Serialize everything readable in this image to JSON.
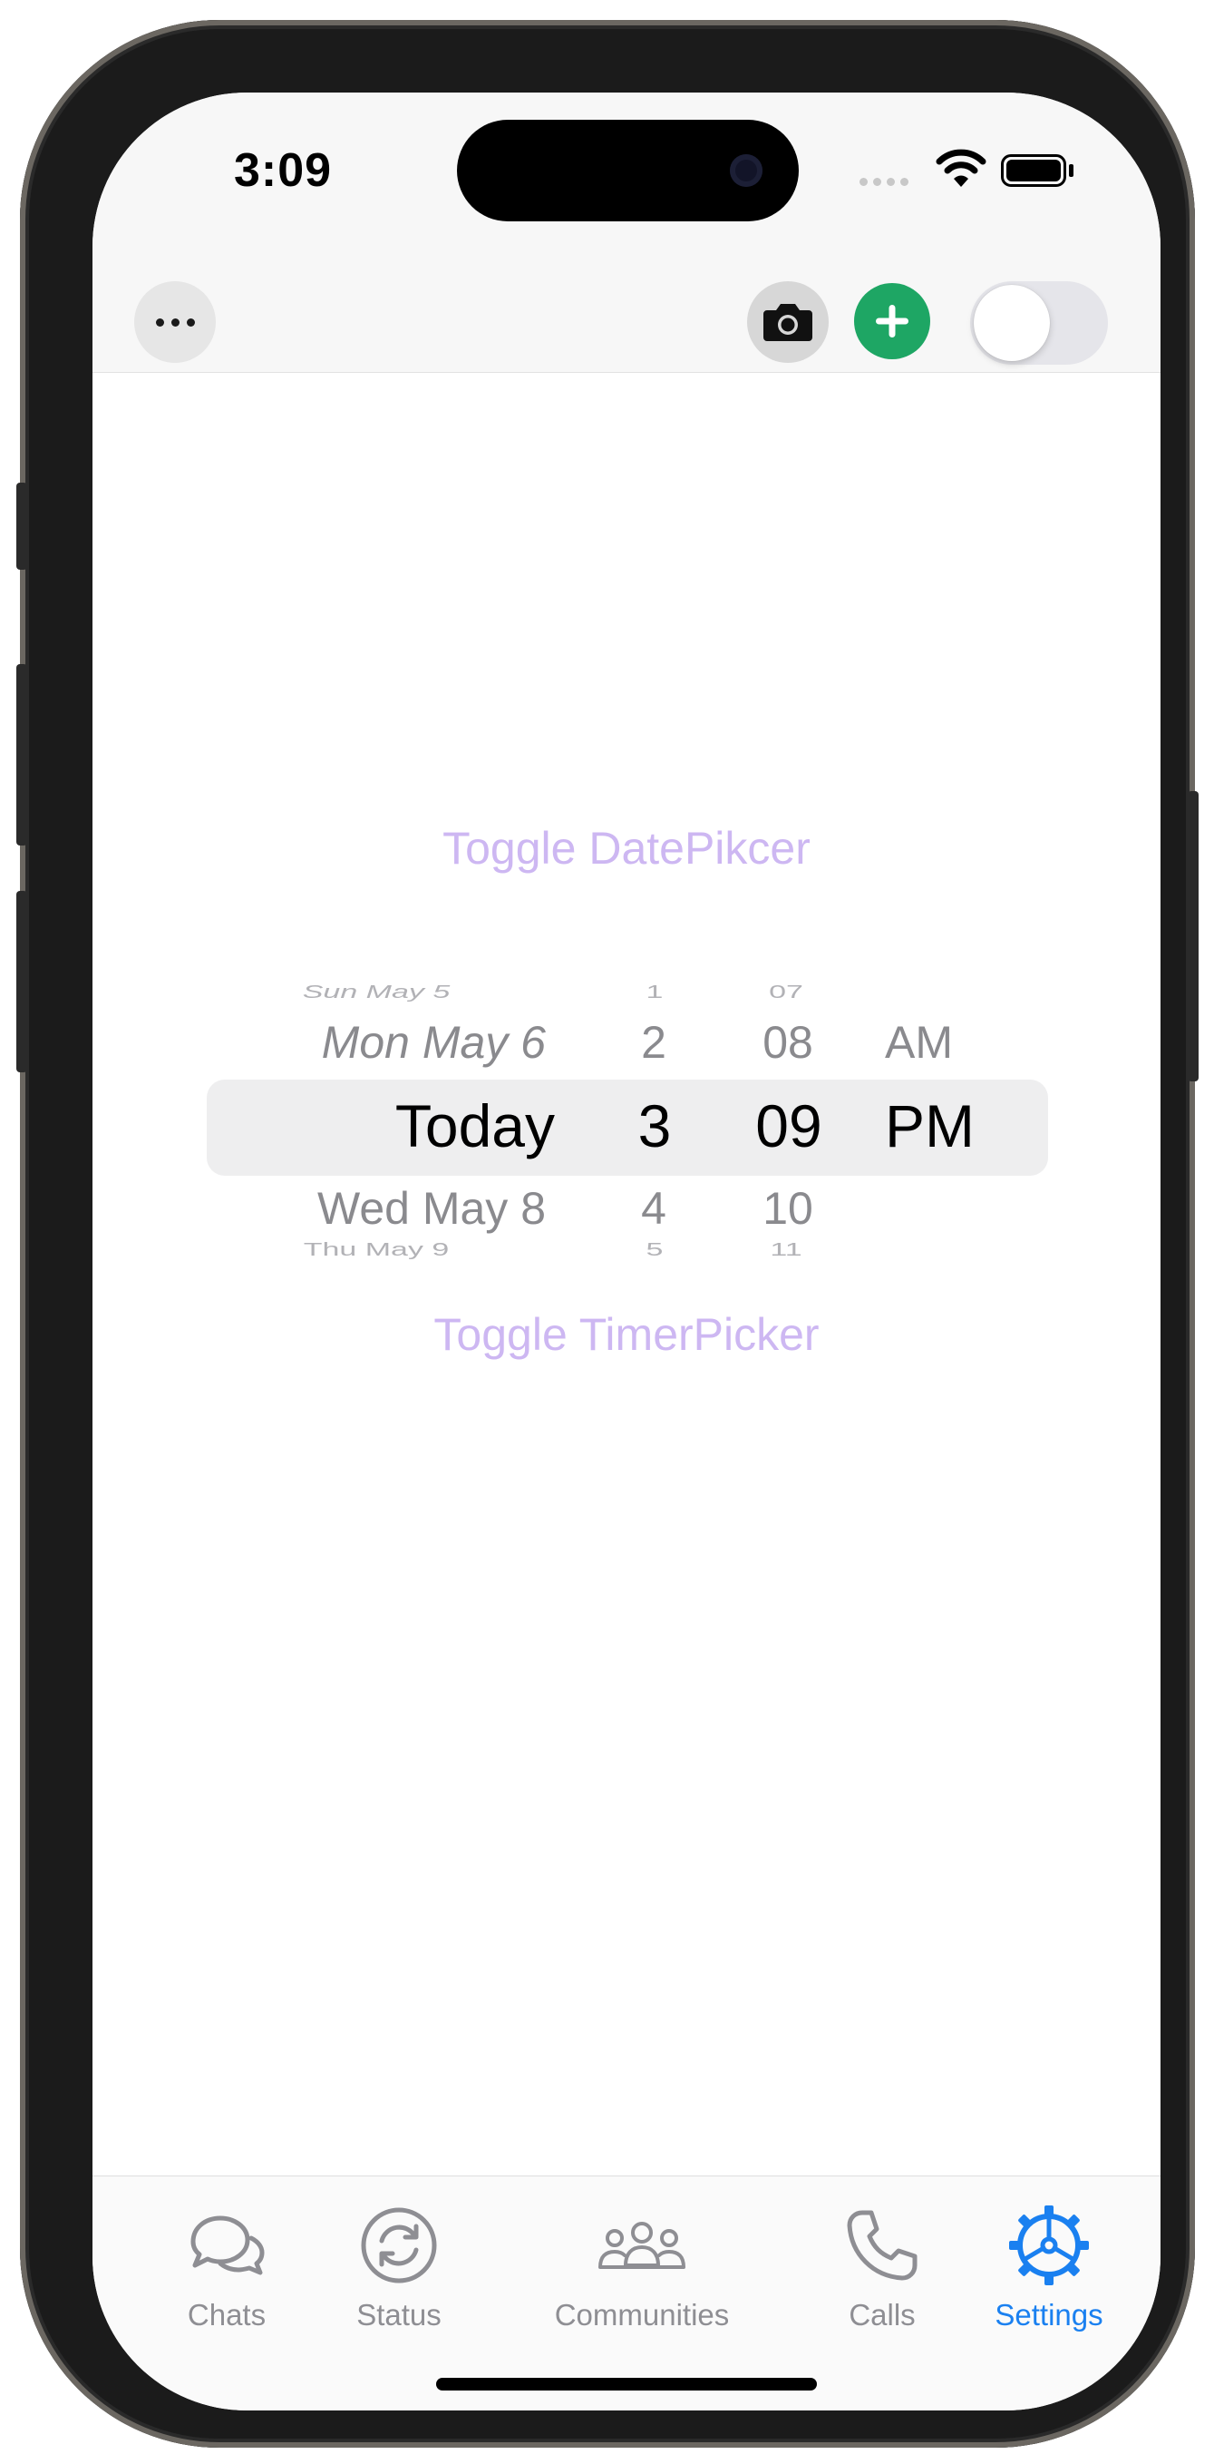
{
  "status_bar": {
    "time": "3:09"
  },
  "toolbar": {
    "more_icon": "ellipsis-icon",
    "camera_icon": "camera-icon",
    "add_icon": "plus-circle-icon",
    "toggle_on": false,
    "accent_color": "#1ea664"
  },
  "links": {
    "toggle_date_picker": "Toggle DatePikcer",
    "toggle_timer_picker": "Toggle TimerPicker",
    "link_color": "#cdb7f2"
  },
  "date_picker": {
    "date_column": {
      "far_above": "Sun May 5",
      "above": "Mon May 6",
      "selected": "Today",
      "below": "Wed May 8",
      "far_below": "Thu May 9"
    },
    "hour_column": {
      "far_above": "1",
      "above": "2",
      "selected": "3",
      "below": "4",
      "far_below": "5"
    },
    "minute_column": {
      "far_above": "07",
      "above": "08",
      "selected": "09",
      "below": "10",
      "far_below": "11"
    },
    "ampm_column": {
      "above": "AM",
      "selected": "PM"
    }
  },
  "tab_bar": {
    "active_color": "#1a80f0",
    "items": [
      {
        "label": "Chats",
        "icon": "chat-bubbles-icon"
      },
      {
        "label": "Status",
        "icon": "status-refresh-icon"
      },
      {
        "label": "Communities",
        "icon": "people-group-icon"
      },
      {
        "label": "Calls",
        "icon": "phone-icon"
      },
      {
        "label": "Settings",
        "icon": "gear-icon"
      }
    ],
    "active_index": 4
  }
}
